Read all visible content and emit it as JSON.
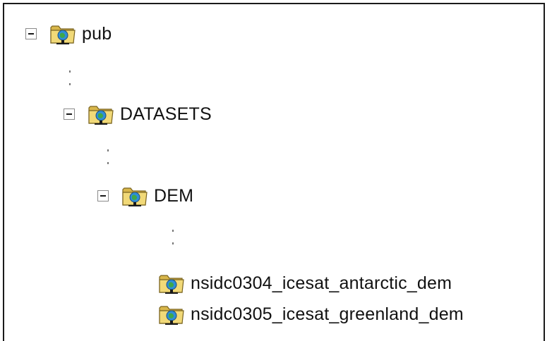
{
  "tree": {
    "root": {
      "label": "pub",
      "icon": "network-folder-icon",
      "expanded": true
    },
    "datasets": {
      "label": "DATASETS",
      "icon": "network-folder-icon",
      "expanded": true
    },
    "dem": {
      "label": "DEM",
      "icon": "network-folder-icon",
      "expanded": true
    },
    "children": [
      {
        "label": "nsidc0304_icesat_antarctic_dem",
        "icon": "network-folder-icon"
      },
      {
        "label": "nsidc0305_icesat_greenland_dem",
        "icon": "network-folder-icon"
      }
    ]
  }
}
